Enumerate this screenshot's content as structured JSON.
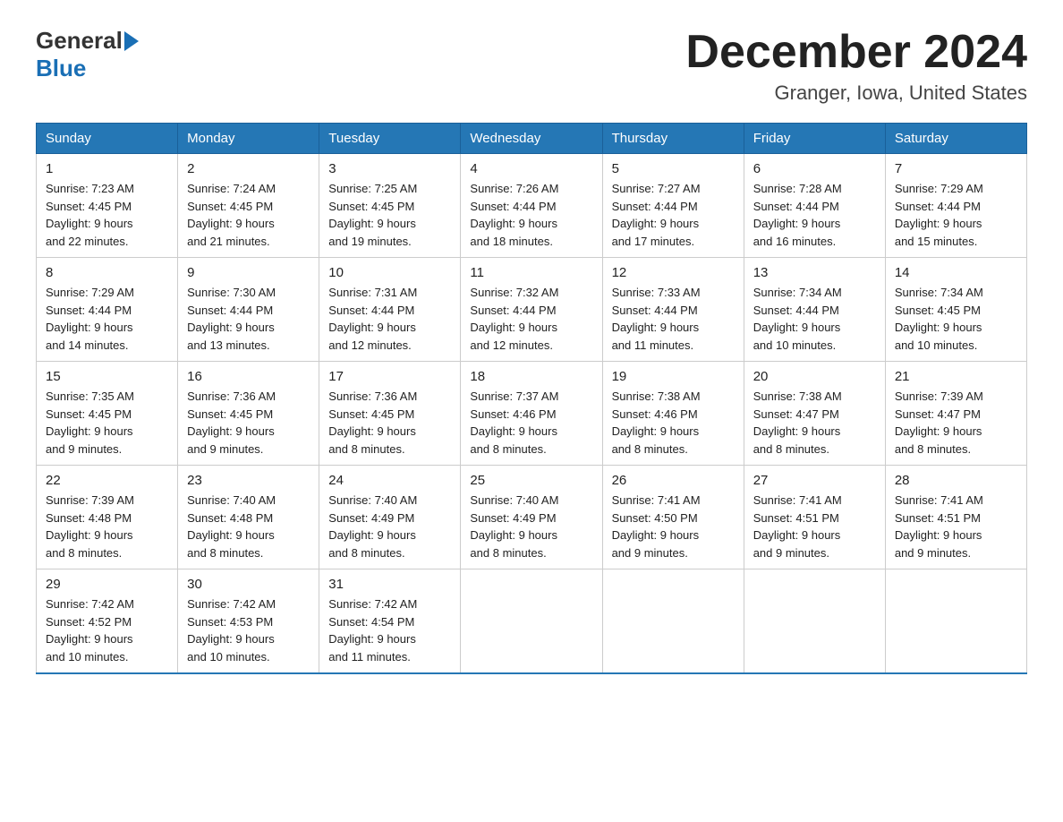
{
  "header": {
    "logo_general": "General",
    "logo_blue": "Blue",
    "month_title": "December 2024",
    "location": "Granger, Iowa, United States"
  },
  "days_of_week": [
    "Sunday",
    "Monday",
    "Tuesday",
    "Wednesday",
    "Thursday",
    "Friday",
    "Saturday"
  ],
  "weeks": [
    [
      {
        "day": "1",
        "sunrise": "7:23 AM",
        "sunset": "4:45 PM",
        "daylight": "9 hours and 22 minutes."
      },
      {
        "day": "2",
        "sunrise": "7:24 AM",
        "sunset": "4:45 PM",
        "daylight": "9 hours and 21 minutes."
      },
      {
        "day": "3",
        "sunrise": "7:25 AM",
        "sunset": "4:45 PM",
        "daylight": "9 hours and 19 minutes."
      },
      {
        "day": "4",
        "sunrise": "7:26 AM",
        "sunset": "4:44 PM",
        "daylight": "9 hours and 18 minutes."
      },
      {
        "day": "5",
        "sunrise": "7:27 AM",
        "sunset": "4:44 PM",
        "daylight": "9 hours and 17 minutes."
      },
      {
        "day": "6",
        "sunrise": "7:28 AM",
        "sunset": "4:44 PM",
        "daylight": "9 hours and 16 minutes."
      },
      {
        "day": "7",
        "sunrise": "7:29 AM",
        "sunset": "4:44 PM",
        "daylight": "9 hours and 15 minutes."
      }
    ],
    [
      {
        "day": "8",
        "sunrise": "7:29 AM",
        "sunset": "4:44 PM",
        "daylight": "9 hours and 14 minutes."
      },
      {
        "day": "9",
        "sunrise": "7:30 AM",
        "sunset": "4:44 PM",
        "daylight": "9 hours and 13 minutes."
      },
      {
        "day": "10",
        "sunrise": "7:31 AM",
        "sunset": "4:44 PM",
        "daylight": "9 hours and 12 minutes."
      },
      {
        "day": "11",
        "sunrise": "7:32 AM",
        "sunset": "4:44 PM",
        "daylight": "9 hours and 12 minutes."
      },
      {
        "day": "12",
        "sunrise": "7:33 AM",
        "sunset": "4:44 PM",
        "daylight": "9 hours and 11 minutes."
      },
      {
        "day": "13",
        "sunrise": "7:34 AM",
        "sunset": "4:44 PM",
        "daylight": "9 hours and 10 minutes."
      },
      {
        "day": "14",
        "sunrise": "7:34 AM",
        "sunset": "4:45 PM",
        "daylight": "9 hours and 10 minutes."
      }
    ],
    [
      {
        "day": "15",
        "sunrise": "7:35 AM",
        "sunset": "4:45 PM",
        "daylight": "9 hours and 9 minutes."
      },
      {
        "day": "16",
        "sunrise": "7:36 AM",
        "sunset": "4:45 PM",
        "daylight": "9 hours and 9 minutes."
      },
      {
        "day": "17",
        "sunrise": "7:36 AM",
        "sunset": "4:45 PM",
        "daylight": "9 hours and 8 minutes."
      },
      {
        "day": "18",
        "sunrise": "7:37 AM",
        "sunset": "4:46 PM",
        "daylight": "9 hours and 8 minutes."
      },
      {
        "day": "19",
        "sunrise": "7:38 AM",
        "sunset": "4:46 PM",
        "daylight": "9 hours and 8 minutes."
      },
      {
        "day": "20",
        "sunrise": "7:38 AM",
        "sunset": "4:47 PM",
        "daylight": "9 hours and 8 minutes."
      },
      {
        "day": "21",
        "sunrise": "7:39 AM",
        "sunset": "4:47 PM",
        "daylight": "9 hours and 8 minutes."
      }
    ],
    [
      {
        "day": "22",
        "sunrise": "7:39 AM",
        "sunset": "4:48 PM",
        "daylight": "9 hours and 8 minutes."
      },
      {
        "day": "23",
        "sunrise": "7:40 AM",
        "sunset": "4:48 PM",
        "daylight": "9 hours and 8 minutes."
      },
      {
        "day": "24",
        "sunrise": "7:40 AM",
        "sunset": "4:49 PM",
        "daylight": "9 hours and 8 minutes."
      },
      {
        "day": "25",
        "sunrise": "7:40 AM",
        "sunset": "4:49 PM",
        "daylight": "9 hours and 8 minutes."
      },
      {
        "day": "26",
        "sunrise": "7:41 AM",
        "sunset": "4:50 PM",
        "daylight": "9 hours and 9 minutes."
      },
      {
        "day": "27",
        "sunrise": "7:41 AM",
        "sunset": "4:51 PM",
        "daylight": "9 hours and 9 minutes."
      },
      {
        "day": "28",
        "sunrise": "7:41 AM",
        "sunset": "4:51 PM",
        "daylight": "9 hours and 9 minutes."
      }
    ],
    [
      {
        "day": "29",
        "sunrise": "7:42 AM",
        "sunset": "4:52 PM",
        "daylight": "9 hours and 10 minutes."
      },
      {
        "day": "30",
        "sunrise": "7:42 AM",
        "sunset": "4:53 PM",
        "daylight": "9 hours and 10 minutes."
      },
      {
        "day": "31",
        "sunrise": "7:42 AM",
        "sunset": "4:54 PM",
        "daylight": "9 hours and 11 minutes."
      },
      null,
      null,
      null,
      null
    ]
  ],
  "labels": {
    "sunrise": "Sunrise:",
    "sunset": "Sunset:",
    "daylight": "Daylight:"
  }
}
